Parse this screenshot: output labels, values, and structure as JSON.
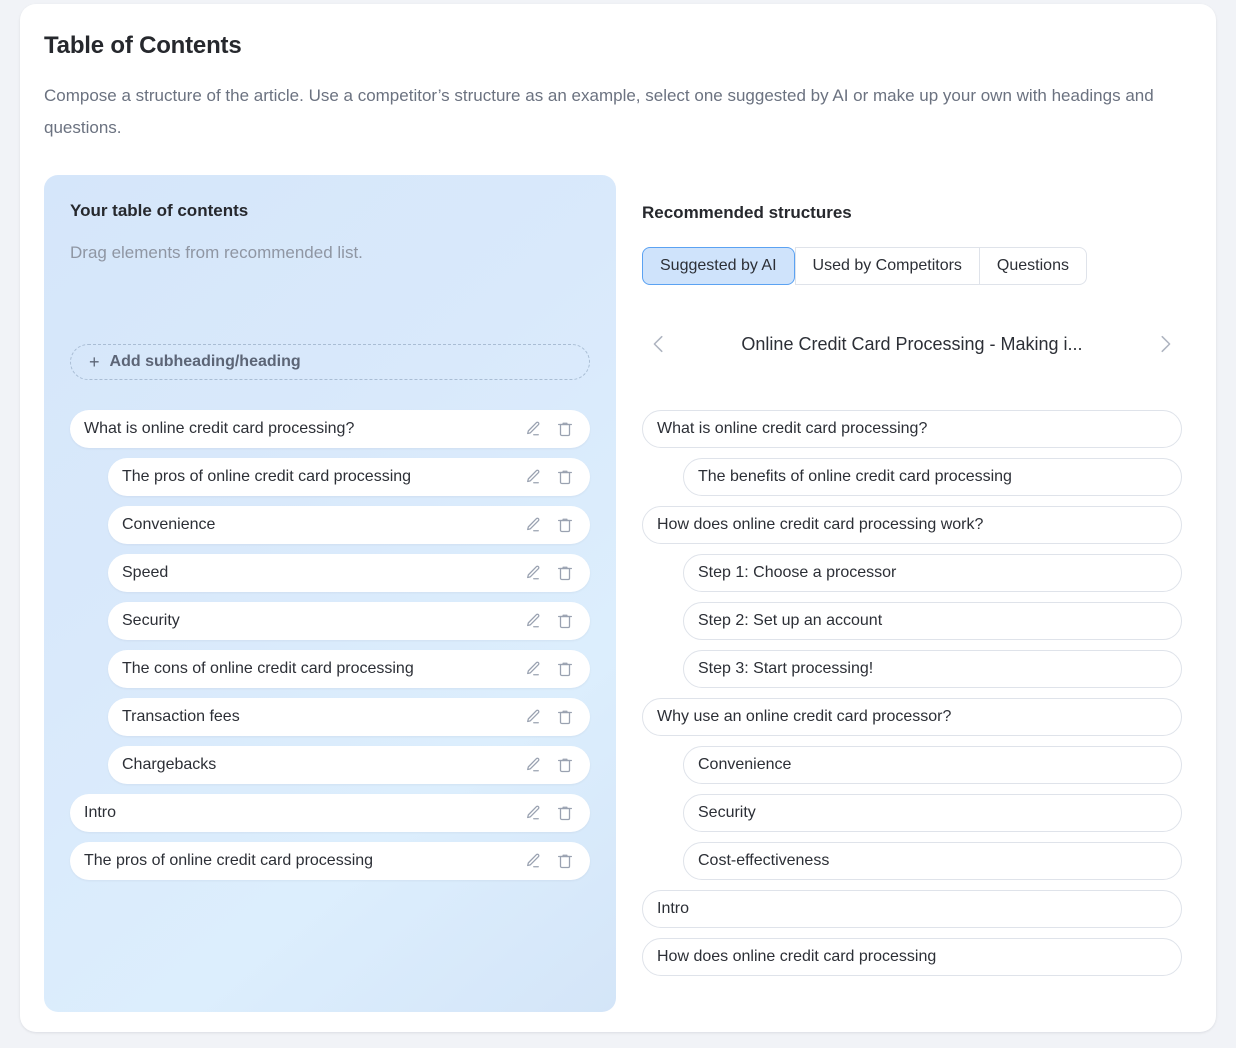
{
  "header": {
    "title": "Table of Contents",
    "subtitle": "Compose a structure of the article. Use a competitor’s structure as an example, select one suggested by AI or make up your own with headings and questions."
  },
  "toc_panel": {
    "title": "Your table of contents",
    "hint": "Drag elements from recommended list.",
    "add_button_label": "Add subheading/heading",
    "add_button_icon": "plus-icon",
    "row_edit_icon": "pencil-icon",
    "row_delete_icon": "trash-icon",
    "items": [
      {
        "label": "What is online credit card processing?",
        "level": 0
      },
      {
        "label": "The pros of online credit card processing",
        "level": 1
      },
      {
        "label": "Convenience",
        "level": 1
      },
      {
        "label": "Speed",
        "level": 1
      },
      {
        "label": "Security",
        "level": 1
      },
      {
        "label": "The cons of online credit card processing",
        "level": 1
      },
      {
        "label": "Transaction fees",
        "level": 1
      },
      {
        "label": "Chargebacks",
        "level": 1
      },
      {
        "label": "Intro",
        "level": 0
      },
      {
        "label": "The pros of online credit card processing",
        "level": 0
      }
    ]
  },
  "recommended_panel": {
    "title": "Recommended structures",
    "tabs": [
      {
        "label": "Suggested by AI",
        "active": true
      },
      {
        "label": "Used by Competitors",
        "active": false
      },
      {
        "label": "Questions",
        "active": false
      }
    ],
    "carousel": {
      "prev_icon": "chevron-left-icon",
      "next_icon": "chevron-right-icon",
      "current_title": "Online Credit Card Processing - Making i..."
    },
    "items": [
      {
        "label": "What is online credit card processing?",
        "level": 0
      },
      {
        "label": "The benefits of online credit card processing",
        "level": 1
      },
      {
        "label": "How does online credit card processing work?",
        "level": 0
      },
      {
        "label": "Step 1: Choose a processor",
        "level": 1
      },
      {
        "label": "Step 2: Set up an account",
        "level": 1
      },
      {
        "label": "Step 3: Start processing!",
        "level": 1
      },
      {
        "label": "Why use an online credit card processor?",
        "level": 0
      },
      {
        "label": "Convenience",
        "level": 1
      },
      {
        "label": "Security",
        "level": 1
      },
      {
        "label": "Cost-effectiveness",
        "level": 1
      },
      {
        "label": "Intro",
        "level": 0
      },
      {
        "label": "How does online credit card processing",
        "level": 0
      }
    ]
  },
  "colors": {
    "page_background": "#f1f3f7",
    "card_background": "#ffffff",
    "toc_panel_gradient_start": "#d5e6fa",
    "toc_panel_gradient_end": "#d4e5f8",
    "active_tab_fill": "#cfe3fb",
    "active_tab_border": "#5ba2f2",
    "row_border": "#dfe3ea",
    "text_primary": "#26282d",
    "text_secondary": "#6b7280",
    "icon_gray": "#9aa2b1"
  }
}
